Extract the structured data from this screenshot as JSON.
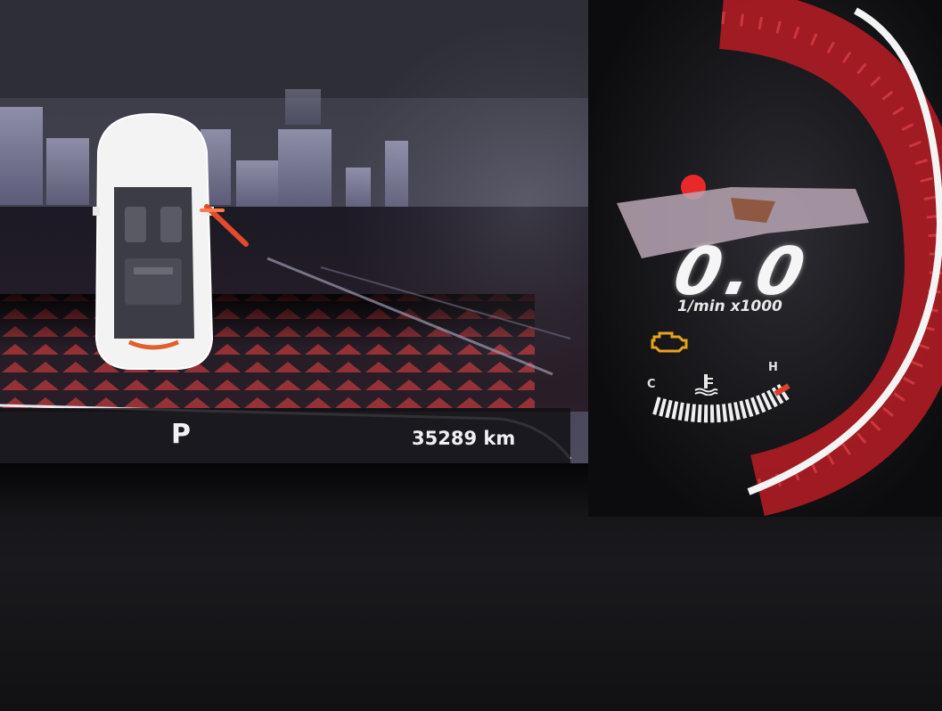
{
  "cluster": {
    "gear_indicator": "P",
    "odometer": "35289 km",
    "tachometer": {
      "digits": "0.0",
      "unit": "1/min x1000"
    },
    "temperature_gauge": {
      "cold_label": "C",
      "hot_label": "H"
    },
    "warning_lights": {
      "check_engine": {
        "state": "on",
        "color": "#e8a21c"
      }
    }
  },
  "colors": {
    "accent_red": "#c8202a",
    "amber_warning": "#e8a21c",
    "display_white": "#f2f2f2"
  }
}
